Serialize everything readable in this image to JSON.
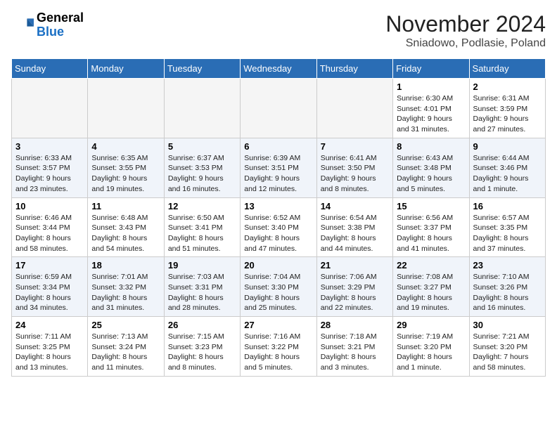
{
  "header": {
    "logo_general": "General",
    "logo_blue": "Blue",
    "month_year": "November 2024",
    "location": "Sniadowo, Podlasie, Poland"
  },
  "weekdays": [
    "Sunday",
    "Monday",
    "Tuesday",
    "Wednesday",
    "Thursday",
    "Friday",
    "Saturday"
  ],
  "weeks": [
    [
      {
        "day": "",
        "info": "",
        "empty": true
      },
      {
        "day": "",
        "info": "",
        "empty": true
      },
      {
        "day": "",
        "info": "",
        "empty": true
      },
      {
        "day": "",
        "info": "",
        "empty": true
      },
      {
        "day": "",
        "info": "",
        "empty": true
      },
      {
        "day": "1",
        "info": "Sunrise: 6:30 AM\nSunset: 4:01 PM\nDaylight: 9 hours\nand 31 minutes."
      },
      {
        "day": "2",
        "info": "Sunrise: 6:31 AM\nSunset: 3:59 PM\nDaylight: 9 hours\nand 27 minutes."
      }
    ],
    [
      {
        "day": "3",
        "info": "Sunrise: 6:33 AM\nSunset: 3:57 PM\nDaylight: 9 hours\nand 23 minutes."
      },
      {
        "day": "4",
        "info": "Sunrise: 6:35 AM\nSunset: 3:55 PM\nDaylight: 9 hours\nand 19 minutes."
      },
      {
        "day": "5",
        "info": "Sunrise: 6:37 AM\nSunset: 3:53 PM\nDaylight: 9 hours\nand 16 minutes."
      },
      {
        "day": "6",
        "info": "Sunrise: 6:39 AM\nSunset: 3:51 PM\nDaylight: 9 hours\nand 12 minutes."
      },
      {
        "day": "7",
        "info": "Sunrise: 6:41 AM\nSunset: 3:50 PM\nDaylight: 9 hours\nand 8 minutes."
      },
      {
        "day": "8",
        "info": "Sunrise: 6:43 AM\nSunset: 3:48 PM\nDaylight: 9 hours\nand 5 minutes."
      },
      {
        "day": "9",
        "info": "Sunrise: 6:44 AM\nSunset: 3:46 PM\nDaylight: 9 hours\nand 1 minute."
      }
    ],
    [
      {
        "day": "10",
        "info": "Sunrise: 6:46 AM\nSunset: 3:44 PM\nDaylight: 8 hours\nand 58 minutes."
      },
      {
        "day": "11",
        "info": "Sunrise: 6:48 AM\nSunset: 3:43 PM\nDaylight: 8 hours\nand 54 minutes."
      },
      {
        "day": "12",
        "info": "Sunrise: 6:50 AM\nSunset: 3:41 PM\nDaylight: 8 hours\nand 51 minutes."
      },
      {
        "day": "13",
        "info": "Sunrise: 6:52 AM\nSunset: 3:40 PM\nDaylight: 8 hours\nand 47 minutes."
      },
      {
        "day": "14",
        "info": "Sunrise: 6:54 AM\nSunset: 3:38 PM\nDaylight: 8 hours\nand 44 minutes."
      },
      {
        "day": "15",
        "info": "Sunrise: 6:56 AM\nSunset: 3:37 PM\nDaylight: 8 hours\nand 41 minutes."
      },
      {
        "day": "16",
        "info": "Sunrise: 6:57 AM\nSunset: 3:35 PM\nDaylight: 8 hours\nand 37 minutes."
      }
    ],
    [
      {
        "day": "17",
        "info": "Sunrise: 6:59 AM\nSunset: 3:34 PM\nDaylight: 8 hours\nand 34 minutes."
      },
      {
        "day": "18",
        "info": "Sunrise: 7:01 AM\nSunset: 3:32 PM\nDaylight: 8 hours\nand 31 minutes."
      },
      {
        "day": "19",
        "info": "Sunrise: 7:03 AM\nSunset: 3:31 PM\nDaylight: 8 hours\nand 28 minutes."
      },
      {
        "day": "20",
        "info": "Sunrise: 7:04 AM\nSunset: 3:30 PM\nDaylight: 8 hours\nand 25 minutes."
      },
      {
        "day": "21",
        "info": "Sunrise: 7:06 AM\nSunset: 3:29 PM\nDaylight: 8 hours\nand 22 minutes."
      },
      {
        "day": "22",
        "info": "Sunrise: 7:08 AM\nSunset: 3:27 PM\nDaylight: 8 hours\nand 19 minutes."
      },
      {
        "day": "23",
        "info": "Sunrise: 7:10 AM\nSunset: 3:26 PM\nDaylight: 8 hours\nand 16 minutes."
      }
    ],
    [
      {
        "day": "24",
        "info": "Sunrise: 7:11 AM\nSunset: 3:25 PM\nDaylight: 8 hours\nand 13 minutes."
      },
      {
        "day": "25",
        "info": "Sunrise: 7:13 AM\nSunset: 3:24 PM\nDaylight: 8 hours\nand 11 minutes."
      },
      {
        "day": "26",
        "info": "Sunrise: 7:15 AM\nSunset: 3:23 PM\nDaylight: 8 hours\nand 8 minutes."
      },
      {
        "day": "27",
        "info": "Sunrise: 7:16 AM\nSunset: 3:22 PM\nDaylight: 8 hours\nand 5 minutes."
      },
      {
        "day": "28",
        "info": "Sunrise: 7:18 AM\nSunset: 3:21 PM\nDaylight: 8 hours\nand 3 minutes."
      },
      {
        "day": "29",
        "info": "Sunrise: 7:19 AM\nSunset: 3:20 PM\nDaylight: 8 hours\nand 1 minute."
      },
      {
        "day": "30",
        "info": "Sunrise: 7:21 AM\nSunset: 3:20 PM\nDaylight: 7 hours\nand 58 minutes."
      }
    ]
  ]
}
